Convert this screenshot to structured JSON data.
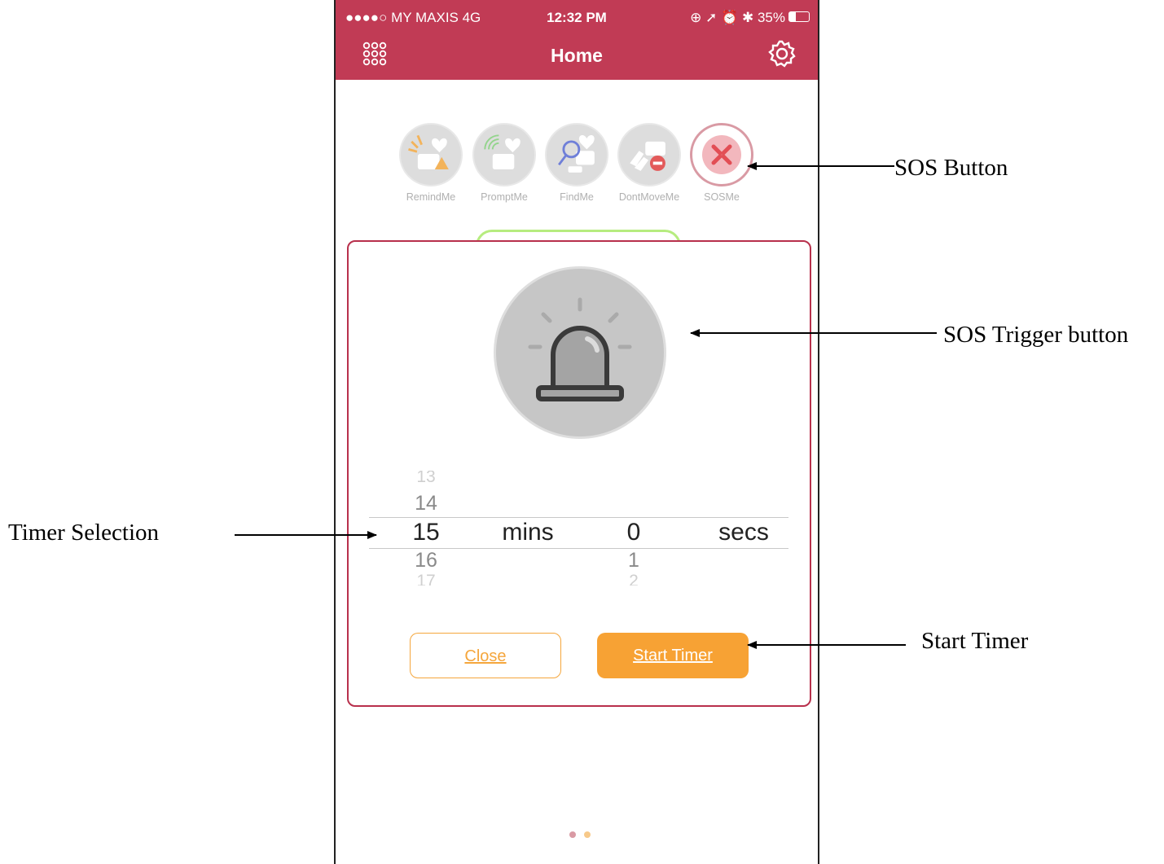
{
  "status_bar": {
    "carrier": "●●●●○ MY MAXIS  4G",
    "time": "12:32 PM",
    "indicators": "⊕ ➚ ⏰ ✱ 35%",
    "battery_level": 0.35
  },
  "nav": {
    "title": "Home",
    "left_icon": "grid-menu-icon",
    "right_icon": "gear-icon"
  },
  "features": [
    {
      "label": "RemindMe",
      "icon": "remind-me-icon"
    },
    {
      "label": "PromptMe",
      "icon": "prompt-me-icon"
    },
    {
      "label": "FindMe",
      "icon": "find-me-icon"
    },
    {
      "label": "DontMoveMe",
      "icon": "dont-move-me-icon"
    },
    {
      "label": "SOSMe",
      "icon": "sos-icon"
    }
  ],
  "modal": {
    "trigger_icon": "siren-icon",
    "picker": {
      "minutes": {
        "above2": "13",
        "above1": "14",
        "selected": "15",
        "below1": "16",
        "below2": "17"
      },
      "minutes_unit": "mins",
      "seconds": {
        "selected": "0",
        "below1": "1",
        "below2": "2"
      },
      "seconds_unit": "secs"
    },
    "close_label": "Close",
    "start_label": "Start Timer"
  },
  "page_dots": {
    "count": 2,
    "active_index": 0
  },
  "annotations": {
    "sos_button": "SOS Button",
    "sos_trigger": "SOS Trigger button",
    "timer_selection": "Timer Selection",
    "start_timer": "Start Timer"
  },
  "colors": {
    "brand": "#c13b55",
    "modal_border": "#b8304c",
    "accent_orange": "#f7a234",
    "pill_green": "#b6ec7f"
  }
}
